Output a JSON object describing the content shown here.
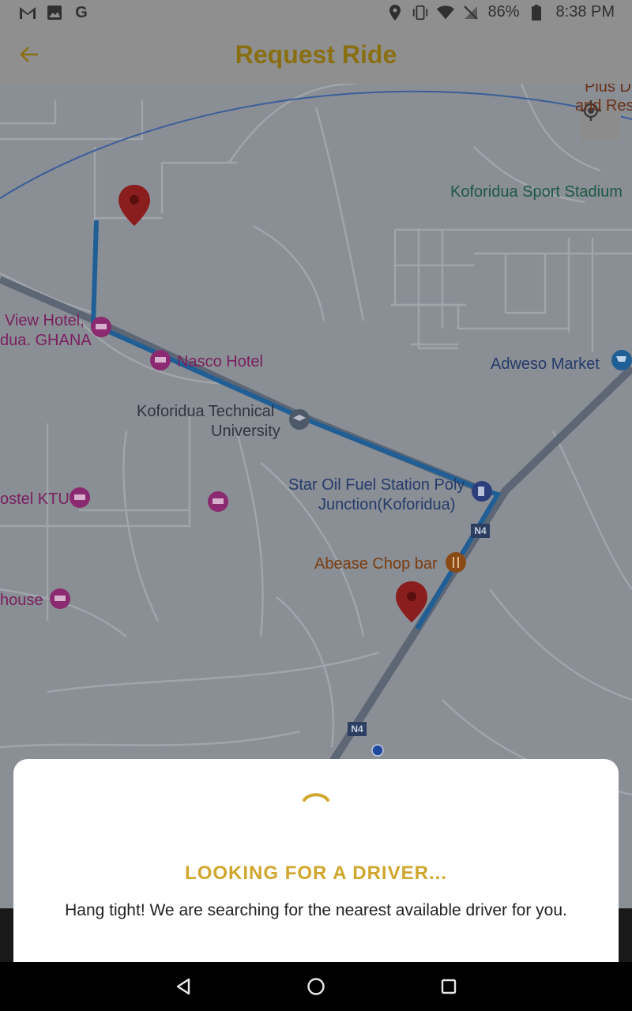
{
  "status_bar": {
    "left_icons": [
      "gmail-icon",
      "image-icon",
      "google-icon"
    ],
    "google_letter": "G",
    "battery": "86%",
    "time": "8:38 PM"
  },
  "app_bar": {
    "title": "Request Ride",
    "title_color": "#8a6f12"
  },
  "map": {
    "labels": {
      "plus_line1": "Plus D",
      "plus_line2": "and Res",
      "sport_stadium": "Koforidua Sport Stadium",
      "view_hotel_line1": "View Hotel,",
      "view_hotel_line2": "dua. GHANA",
      "nasco_hotel": "Nasco Hotel",
      "adweso_market": "Adweso Market",
      "ktu_line1": "Koforidua Technical",
      "ktu_line2": "University",
      "star_oil_line1": "Star Oil Fuel Station Poly",
      "star_oil_line2": "Junction(Koforidua)",
      "hostel_ktu": "ostel KTU",
      "abease": "Abease Chop bar",
      "house": "house",
      "n4_top": "N4",
      "n4_bottom": "N4"
    },
    "route_color": "#1f5f96"
  },
  "dialog": {
    "title": "LOOKING FOR A DRIVER...",
    "message": "Hang tight! We are searching for the nearest available driver for you.",
    "accent": "#d0a62c"
  },
  "nav_bar": {
    "buttons": [
      "back-triangle-icon",
      "home-circle-icon",
      "recents-square-icon"
    ]
  }
}
